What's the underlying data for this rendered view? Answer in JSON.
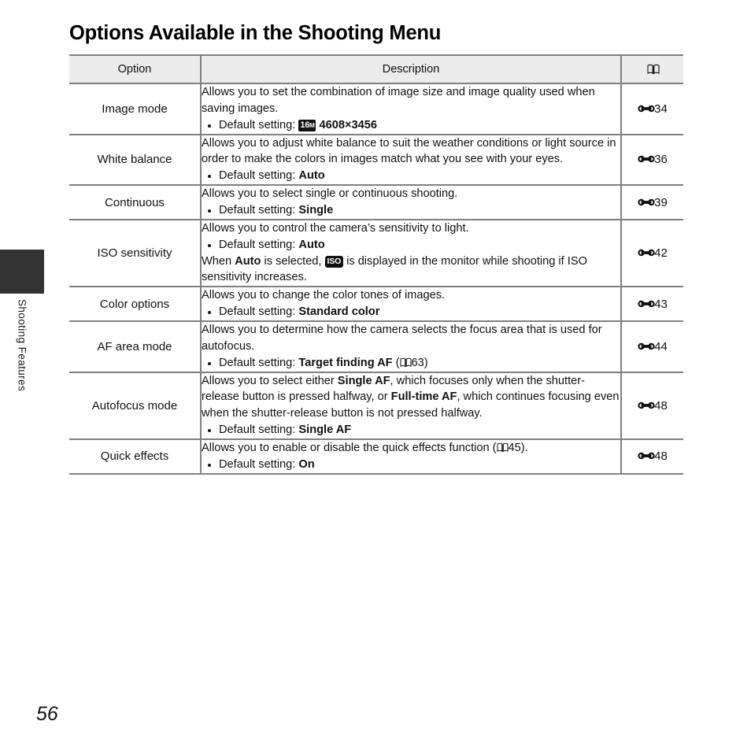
{
  "page": {
    "title": "Options Available in the Shooting Menu",
    "page_number": "56",
    "side_tab_label": "Shooting Features"
  },
  "icons": {
    "book": "book-icon",
    "reference": "reference-mark-icon",
    "image_mode_badge": "16m-image-size-icon",
    "iso_badge": "iso-auto-indicator-icon"
  },
  "table": {
    "headers": {
      "option": "Option",
      "description": "Description",
      "reference": "book-icon"
    },
    "rows": [
      {
        "option": "Image mode",
        "lines": [
          "Allows you to set the combination of image size and image quality used when saving images."
        ],
        "bullets_prefix": "Default setting:",
        "bullet_value": "4608×3456",
        "badge": "16M",
        "reference": "34"
      },
      {
        "option": "White balance",
        "lines": [
          "Allows you to adjust white balance to suit the weather conditions or light source in order to make the colors in images match what you see with your eyes."
        ],
        "bullets_prefix": "Default setting:",
        "bullet_value": "Auto",
        "reference": "36"
      },
      {
        "option": "Continuous",
        "lines": [
          "Allows you to select single or continuous shooting."
        ],
        "bullets_prefix": "Default setting:",
        "bullet_value": "Single",
        "reference": "39"
      },
      {
        "option": "ISO sensitivity",
        "lines": [
          "Allows you to control the camera’s sensitivity to light."
        ],
        "bullets_prefix": "Default setting:",
        "bullet_value": "Auto",
        "trailing_a": "When ",
        "trailing_b": "Auto",
        "trailing_c": " is selected, ",
        "trailing_d": " is displayed in the monitor while shooting if ISO sensitivity increases.",
        "reference": "42"
      },
      {
        "option": "Color options",
        "lines": [
          "Allows you to change the color tones of images."
        ],
        "bullets_prefix": "Default setting:",
        "bullet_value": "Standard color",
        "reference": "43"
      },
      {
        "option": "AF area mode",
        "lines": [
          "Allows you to determine how the camera selects the focus area that is used for autofocus."
        ],
        "bullets_prefix": "Default setting:",
        "bullet_value": "Target finding AF",
        "bullet_ref_open": " (",
        "bullet_ref_num": "63",
        "bullet_ref_close": ")",
        "reference": "44"
      },
      {
        "option": "Autofocus mode",
        "rich": {
          "a": "Allows you to select either ",
          "b": "Single AF",
          "c": ", which focuses only when the shutter-release button is pressed halfway, or ",
          "d": "Full-time AF",
          "e": ", which continues focusing even when the shutter-release button is not pressed halfway."
        },
        "bullets_prefix": "Default setting:",
        "bullet_value": "Single AF",
        "reference": "48"
      },
      {
        "option": "Quick effects",
        "rich2": {
          "a": "Allows you to enable or disable the quick effects function (",
          "num": "45",
          "b": ")."
        },
        "bullets_prefix": "Default setting:",
        "bullet_value": "On",
        "reference": "48"
      }
    ]
  }
}
